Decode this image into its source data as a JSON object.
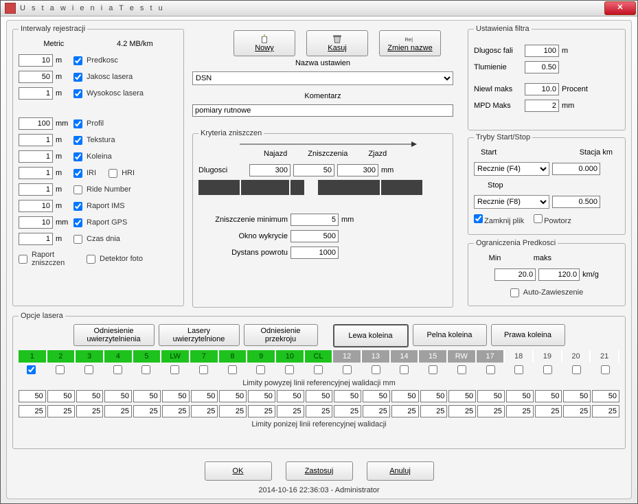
{
  "window": {
    "title": "U s t a w i e n i a   T e s t u"
  },
  "toolbar": {
    "new_label": "Nowy",
    "delete_label": "Kasuj",
    "rename_label": "Zmien nazwe"
  },
  "settings_name_title": "Nazwa ustawien",
  "settings_name_value": "DSN",
  "comment_title": "Komentarz",
  "comment_value": "pomiary rutnowe",
  "intervals": {
    "legend": "Interwaly rejestracji",
    "metric_label": "Metric",
    "rate_label": "4.2 MB/km",
    "predkosc_val": "10",
    "predkosc_unit": "m",
    "predkosc_label": "Predkosc",
    "jakosc_val": "50",
    "jakosc_unit": "m",
    "jakosc_label": "Jakosc lasera",
    "wysokosc_val": "1",
    "wysokosc_unit": "m",
    "wysokosc_label": "Wysokosc lasera",
    "profil_val": "100",
    "profil_unit": "mm",
    "profil_label": "Profil",
    "tekstura_val": "1",
    "tekstura_unit": "m",
    "tekstura_label": "Tekstura",
    "koleina_val": "1",
    "koleina_unit": "m",
    "koleina_label": "Koleina",
    "iri_val": "1",
    "iri_unit": "m",
    "iri_label": "IRI",
    "hri_label": "HRI",
    "ride_val": "1",
    "ride_unit": "m",
    "ride_label": "Ride Number",
    "rims_val": "10",
    "rims_unit": "m",
    "rims_label": "Raport IMS",
    "rgps_val": "10",
    "rgps_unit": "mm",
    "rgps_label": "Raport GPS",
    "czas_val": "1",
    "czas_unit": "m",
    "czas_label": "Czas dnia",
    "raport_zniszczen_label": "Raport zniszczen",
    "detektor_foto_label": "Detektor foto"
  },
  "damage": {
    "legend": "Kryteria zniszczen",
    "naj_label": "Najazd",
    "zni_label": "Zniszczenia",
    "zja_label": "Zjazd",
    "dlugosci_label": "Dlugosci",
    "dlugosci_naj": "300",
    "dlugosci_zni": "50",
    "dlugosci_zja": "300",
    "dlugosci_unit": "mm",
    "min_label": "Zniszczenie minimum",
    "min_val": "5",
    "min_unit": "mm",
    "okno_label": "Okno wykrycie",
    "okno_val": "500",
    "powrot_label": "Dystans powrotu",
    "powrot_val": "1000"
  },
  "filter": {
    "legend": "Ustawienia filtra",
    "dlugosc_label": "Dlugosc fali",
    "dlugosc_val": "100",
    "dlugosc_unit": "m",
    "tlum_label": "Tlumienie",
    "tlum_val": "0.50",
    "niewl_label": "Niewl maks",
    "niewl_val": "10.0",
    "niewl_unit": "Procent",
    "mpd_label": "MPD Maks",
    "mpd_val": "2",
    "mpd_unit": "mm"
  },
  "startstop": {
    "legend": "Tryby Start/Stop",
    "start_label": "Start",
    "stacja_label": "Stacja  km",
    "start_mode": "Recznie (F4)",
    "start_stacja": "0.000",
    "stop_label": "Stop",
    "stop_mode": "Recznie (F8)",
    "stop_stacja": "0.500",
    "zamknij_label": "Zamknij plik",
    "powtorz_label": "Powtorz"
  },
  "speed": {
    "legend": "Ograniczenia Predkosci",
    "min_label": "Min",
    "maks_label": "maks",
    "min_val": "20.0",
    "maks_val": "120.0",
    "unit": "km/g",
    "auto_label": "Auto-Zawieszenie"
  },
  "lasers": {
    "legend": "Opcje lasera",
    "btn_odn_uw": "Odniesienie uwierzytelnienia",
    "btn_las_uw": "Lasery uwierzytelnione",
    "btn_odn_prz": "Odniesienie przekroju",
    "btn_lewa": "Lewa koleina",
    "btn_pelna": "Pelna koleina",
    "btn_prawa": "Prawa koleina",
    "head": [
      "1",
      "2",
      "3",
      "4",
      "5",
      "LW",
      "7",
      "8",
      "9",
      "10",
      "CL",
      "12",
      "13",
      "14",
      "15",
      "RW",
      "17",
      "18",
      "19",
      "20",
      "21"
    ],
    "head_class": [
      "green",
      "green",
      "green",
      "green",
      "green",
      "green",
      "green",
      "green",
      "green",
      "green",
      "green",
      "gray",
      "gray",
      "gray",
      "gray",
      "gray",
      "gray",
      "plain",
      "plain",
      "plain",
      "plain"
    ],
    "cb": [
      true,
      false,
      false,
      false,
      false,
      false,
      false,
      false,
      false,
      false,
      false,
      false,
      false,
      false,
      false,
      false,
      false,
      false,
      false,
      false,
      false
    ],
    "limits_above_label": "Limity powyzej linii referencyjnej walidacji   mm",
    "limits_above": [
      "50",
      "50",
      "50",
      "50",
      "50",
      "50",
      "50",
      "50",
      "50",
      "50",
      "50",
      "50",
      "50",
      "50",
      "50",
      "50",
      "50",
      "50",
      "50",
      "50",
      "50"
    ],
    "limits_below": [
      "25",
      "25",
      "25",
      "25",
      "25",
      "25",
      "25",
      "25",
      "25",
      "25",
      "25",
      "25",
      "25",
      "25",
      "25",
      "25",
      "25",
      "25",
      "25",
      "25",
      "25"
    ],
    "limits_below_label": "Limity ponizej linii referencyjnej walidacji"
  },
  "buttons": {
    "ok": "OK",
    "apply": "Zastosuj",
    "cancel": "Anuluj"
  },
  "status": "2014-10-16 22:36:03 - Administrator"
}
